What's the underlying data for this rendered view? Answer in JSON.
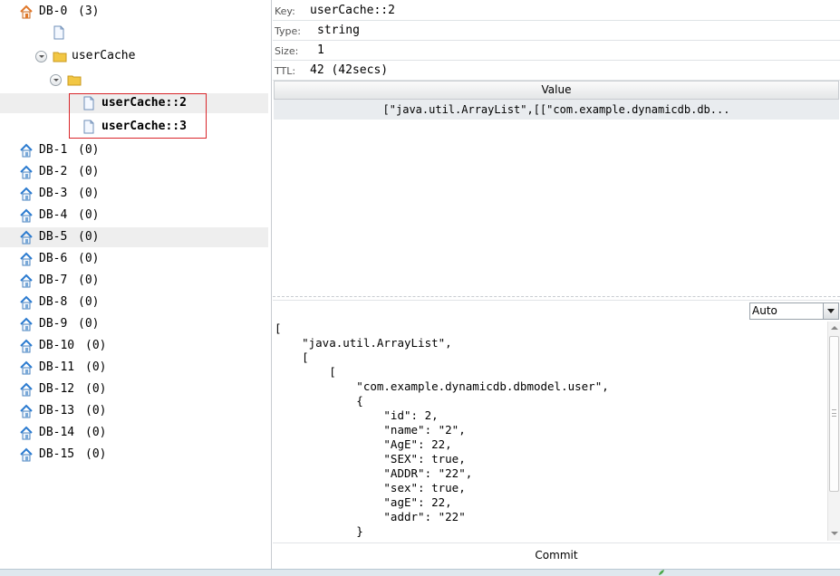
{
  "tree": {
    "db0": {
      "label": "DB-0",
      "count": "(3)"
    },
    "key_group": "userCache",
    "keys": [
      "userCache::2",
      "userCache::3"
    ],
    "databases": [
      {
        "label": "DB-1",
        "count": "(0)"
      },
      {
        "label": "DB-2",
        "count": "(0)"
      },
      {
        "label": "DB-3",
        "count": "(0)"
      },
      {
        "label": "DB-4",
        "count": "(0)"
      },
      {
        "label": "DB-5",
        "count": "(0)"
      },
      {
        "label": "DB-6",
        "count": "(0)"
      },
      {
        "label": "DB-7",
        "count": "(0)"
      },
      {
        "label": "DB-8",
        "count": "(0)"
      },
      {
        "label": "DB-9",
        "count": "(0)"
      },
      {
        "label": "DB-10",
        "count": "(0)"
      },
      {
        "label": "DB-11",
        "count": "(0)"
      },
      {
        "label": "DB-12",
        "count": "(0)"
      },
      {
        "label": "DB-13",
        "count": "(0)"
      },
      {
        "label": "DB-14",
        "count": "(0)"
      },
      {
        "label": "DB-15",
        "count": "(0)"
      }
    ],
    "icons": {
      "database": "home-database-icon",
      "file": "document-icon",
      "folder": "folder-icon",
      "toggle": "collapse-toggle-icon"
    }
  },
  "detail": {
    "key_label": "Key:",
    "key_value": "userCache::2",
    "type_label": "Type:",
    "type_value": "string",
    "size_label": "Size:",
    "size_value": "1",
    "ttl_label": "TTL:",
    "ttl_value": "42 (42secs)",
    "grid_header": "Value",
    "grid_value": "[\"java.util.ArrayList\",[[\"com.example.dynamicdb.db...",
    "format_select": "Auto",
    "editor_text": "[\n    \"java.util.ArrayList\",\n    [\n        [\n            \"com.example.dynamicdb.dbmodel.user\",\n            {\n                \"id\": 2,\n                \"name\": \"2\",\n                \"AgE\": 22,\n                \"SEX\": true,\n                \"ADDR\": \"22\",\n                \"sex\": true,\n                \"agE\": 22,\n                \"addr\": \"22\"\n            }",
    "commit_label": "Commit"
  },
  "colors": {
    "selection_box": "#d9262a",
    "row_highlight": "#eeeeee",
    "database_icon_roof": "#2b7bd0",
    "db0_icon_roof": "#e0782a",
    "folder": "#f2c744"
  }
}
